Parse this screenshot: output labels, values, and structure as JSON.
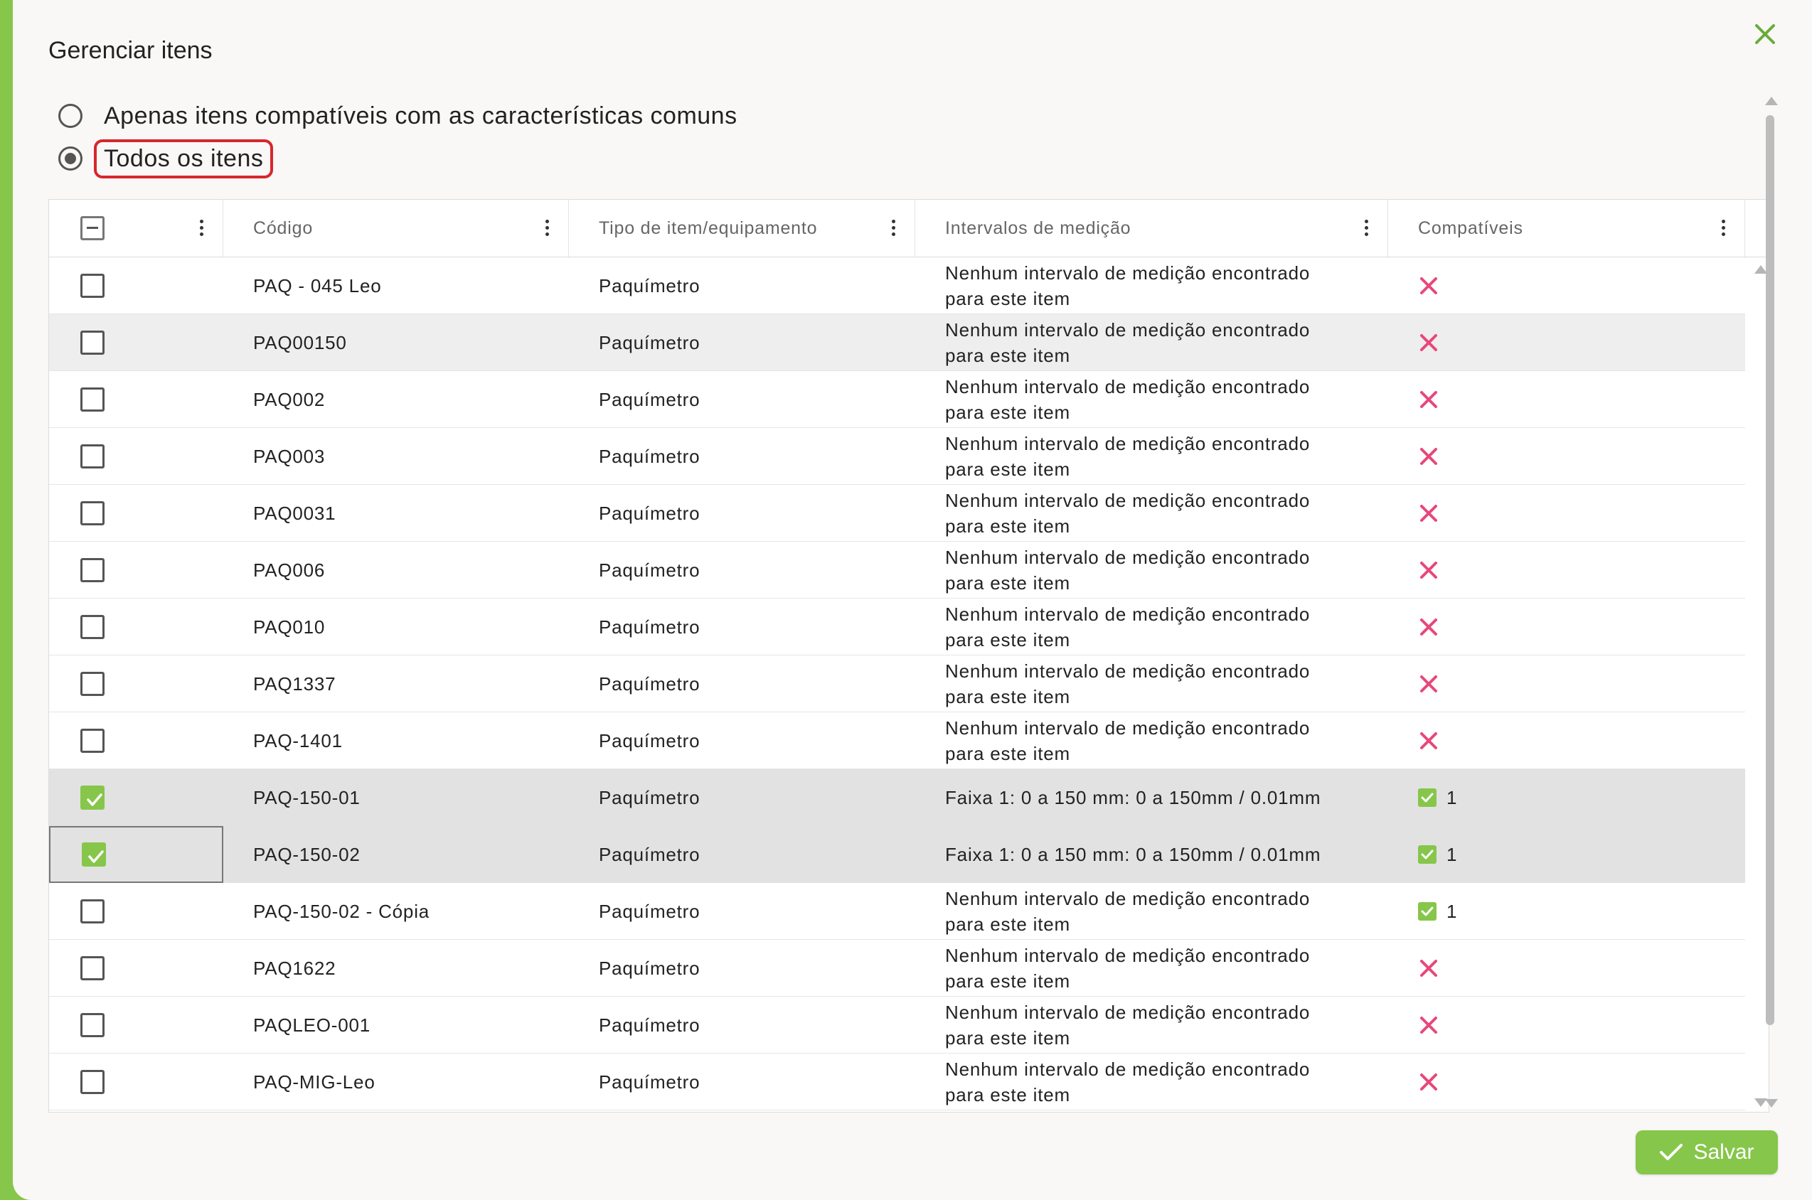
{
  "dialog": {
    "title": "Gerenciar itens"
  },
  "filter": {
    "option_compatible": "Apenas itens compatíveis com as características comuns",
    "option_all": "Todos os itens",
    "selected": "all"
  },
  "table": {
    "headers": {
      "code": "Código",
      "type": "Tipo de item/equipamento",
      "intervals": "Intervalos de medição",
      "compatible": "Compatíveis"
    },
    "rows": [
      {
        "checked": false,
        "code": "PAQ - 045 Leo",
        "type": "Paquímetro",
        "interval_line1": "Nenhum intervalo de medição encontrado",
        "interval_line2": "para este item",
        "compatible": false,
        "compat_count": ""
      },
      {
        "checked": false,
        "code": "PAQ00150",
        "type": "Paquímetro",
        "interval_line1": "Nenhum intervalo de medição encontrado",
        "interval_line2": "para este item",
        "compatible": false,
        "compat_count": ""
      },
      {
        "checked": false,
        "code": "PAQ002",
        "type": "Paquímetro",
        "interval_line1": "Nenhum intervalo de medição encontrado",
        "interval_line2": "para este item",
        "compatible": false,
        "compat_count": ""
      },
      {
        "checked": false,
        "code": "PAQ003",
        "type": "Paquímetro",
        "interval_line1": "Nenhum intervalo de medição encontrado",
        "interval_line2": "para este item",
        "compatible": false,
        "compat_count": ""
      },
      {
        "checked": false,
        "code": "PAQ0031",
        "type": "Paquímetro",
        "interval_line1": "Nenhum intervalo de medição encontrado",
        "interval_line2": "para este item",
        "compatible": false,
        "compat_count": ""
      },
      {
        "checked": false,
        "code": "PAQ006",
        "type": "Paquímetro",
        "interval_line1": "Nenhum intervalo de medição encontrado",
        "interval_line2": "para este item",
        "compatible": false,
        "compat_count": ""
      },
      {
        "checked": false,
        "code": "PAQ010",
        "type": "Paquímetro",
        "interval_line1": "Nenhum intervalo de medição encontrado",
        "interval_line2": "para este item",
        "compatible": false,
        "compat_count": ""
      },
      {
        "checked": false,
        "code": "PAQ1337",
        "type": "Paquímetro",
        "interval_line1": "Nenhum intervalo de medição encontrado",
        "interval_line2": "para este item",
        "compatible": false,
        "compat_count": ""
      },
      {
        "checked": false,
        "code": "PAQ-1401",
        "type": "Paquímetro",
        "interval_line1": "Nenhum intervalo de medição encontrado",
        "interval_line2": "para este item",
        "compatible": false,
        "compat_count": ""
      },
      {
        "checked": true,
        "code": "PAQ-150-01",
        "type": "Paquímetro",
        "interval_line1": "Faixa 1: 0 a 150 mm: 0 a 150mm / 0.01mm",
        "interval_line2": "",
        "compatible": true,
        "compat_count": "1"
      },
      {
        "checked": true,
        "code": "PAQ-150-02",
        "type": "Paquímetro",
        "interval_line1": "Faixa 1: 0 a 150 mm: 0 a 150mm / 0.01mm",
        "interval_line2": "",
        "compatible": true,
        "compat_count": "1"
      },
      {
        "checked": false,
        "code": "PAQ-150-02 - Cópia",
        "type": "Paquímetro",
        "interval_line1": "Nenhum intervalo de medição encontrado",
        "interval_line2": "para este item",
        "compatible": true,
        "compat_count": "1"
      },
      {
        "checked": false,
        "code": "PAQ1622",
        "type": "Paquímetro",
        "interval_line1": "Nenhum intervalo de medição encontrado",
        "interval_line2": "para este item",
        "compatible": false,
        "compat_count": ""
      },
      {
        "checked": false,
        "code": "PAQLEO-001",
        "type": "Paquímetro",
        "interval_line1": "Nenhum intervalo de medição encontrado",
        "interval_line2": "para este item",
        "compatible": false,
        "compat_count": ""
      },
      {
        "checked": false,
        "code": "PAQ-MIG-Leo",
        "type": "Paquímetro",
        "interval_line1": "Nenhum intervalo de medição encontrado",
        "interval_line2": "para este item",
        "compatible": false,
        "compat_count": ""
      }
    ]
  },
  "footer": {
    "save_label": "Salvar"
  },
  "colors": {
    "accent": "#86c64a",
    "highlight_border": "#d8262c",
    "incompatible": "#e8477a"
  },
  "icons": {
    "close": "close-icon",
    "save": "check-icon",
    "incompatible": "x-mark-icon",
    "compatible": "checkbox-checked-icon",
    "column_menu": "kebab-menu-icon"
  }
}
